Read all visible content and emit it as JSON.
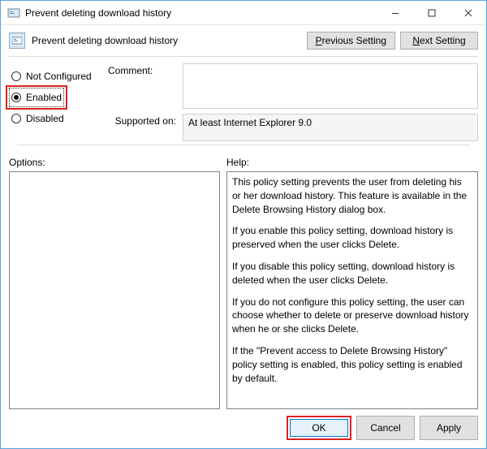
{
  "window": {
    "title": "Prevent deleting download history"
  },
  "header": {
    "policy_title": "Prevent deleting download history",
    "prev_btn_prefix": "P",
    "prev_btn_rest": "revious Setting",
    "next_btn_prefix": "N",
    "next_btn_rest": "ext Setting"
  },
  "radios": {
    "not_configured": "Not Configured",
    "enabled": "Enabled",
    "disabled": "Disabled",
    "selected": "enabled"
  },
  "labels": {
    "comment": "Comment:",
    "supported_on": "Supported on:",
    "options": "Options:",
    "help": "Help:"
  },
  "fields": {
    "comment_value": "",
    "supported_text": "At least Internet Explorer 9.0"
  },
  "help_paragraphs": [
    "This policy setting prevents the user from deleting his or her download history. This feature is available in the Delete Browsing History dialog box.",
    "If you enable this policy setting, download history is preserved when the user clicks Delete.",
    "If you disable this policy setting, download history is deleted when the user clicks Delete.",
    "If you do not configure this policy setting, the user can choose whether to delete or preserve download history when he or she clicks Delete.",
    "If the \"Prevent access to Delete Browsing History\" policy setting is enabled, this policy setting is enabled by default."
  ],
  "footer": {
    "ok": "OK",
    "cancel": "Cancel",
    "apply": "Apply"
  }
}
